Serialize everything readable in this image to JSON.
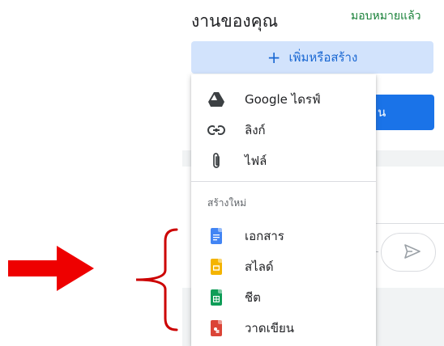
{
  "header": {
    "title": "งานของคุณ",
    "assigned_link": "มอบหมายแล้ว"
  },
  "add_button": {
    "plus": "+",
    "label": "เพิ่มหรือสร้าง"
  },
  "blue_button": {
    "label": "น"
  },
  "menu": {
    "items": [
      {
        "label": "Google ไดรฟ์",
        "icon": "google-drive-icon"
      },
      {
        "label": "ลิงก์",
        "icon": "link-icon"
      },
      {
        "label": "ไฟล์",
        "icon": "paperclip-icon"
      }
    ],
    "section_title": "สร้างใหม่",
    "create_items": [
      {
        "label": "เอกสาร",
        "icon": "google-docs-icon",
        "color": "#4285f4"
      },
      {
        "label": "สไลด์",
        "icon": "google-slides-icon",
        "color": "#f4b400"
      },
      {
        "label": "ชีต",
        "icon": "google-sheets-icon",
        "color": "#0f9d58"
      },
      {
        "label": "วาดเขียน",
        "icon": "google-drawings-icon",
        "color": "#db4437"
      }
    ]
  },
  "annotation": {
    "arrow_color": "#ee0000",
    "brace_color": "#cc0000"
  }
}
